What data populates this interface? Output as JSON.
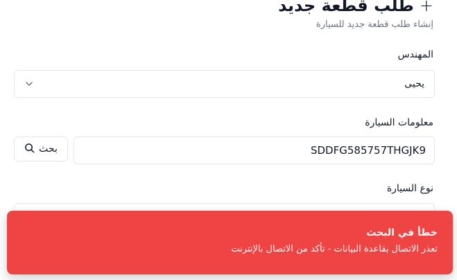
{
  "header": {
    "title": "طلب قطعة جديد",
    "plus_icon": "+",
    "subtitle": "إنشاء طلب قطعة جديد للسيارة"
  },
  "form": {
    "engineer": {
      "label": "المهندس",
      "value": "يحيى",
      "icon": "chevron-down-icon"
    },
    "car_info": {
      "label": "معلومات السيارة",
      "value": "SDDFG585757THGJK9",
      "search_label": "بحث",
      "search_icon": "search-icon"
    },
    "car_type": {
      "label": "نوع السيارة"
    }
  },
  "toast": {
    "title": "خطأ في البحث",
    "description": "تعذر الاتصال بقاعدة البيانات - تأكد من الاتصال بالإنترنت",
    "color": "#ef4444"
  }
}
